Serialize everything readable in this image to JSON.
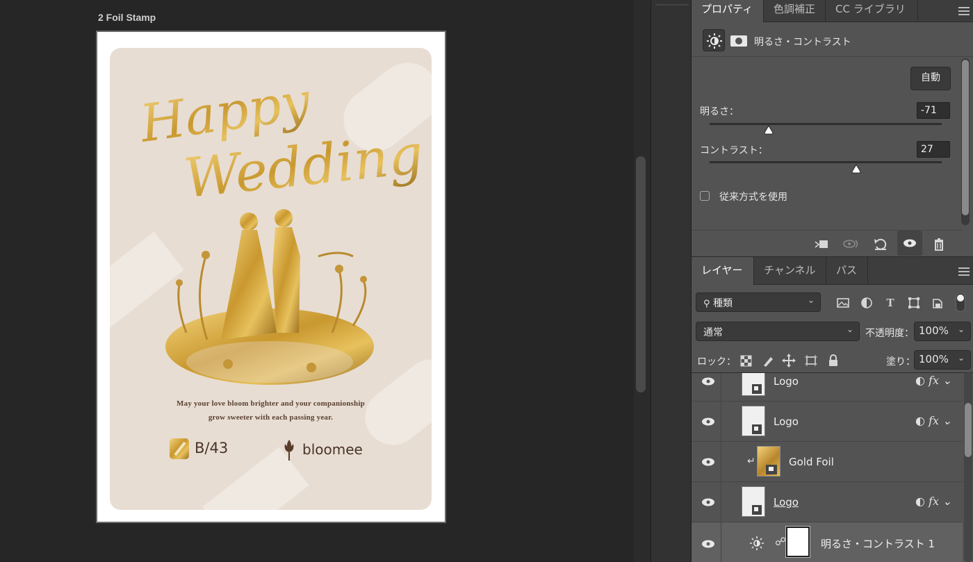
{
  "document": {
    "title": "2 Foil Stamp",
    "card": {
      "headline_1": "Happy",
      "headline_2": "Wedding",
      "tagline_1": "May your love bloom brighter and your companionship",
      "tagline_2": "grow sweeter with each passing year.",
      "logo_left": "B/43",
      "logo_right": "bloomee"
    }
  },
  "properties_panel": {
    "tabs": [
      {
        "label": "プロパティ",
        "active": true
      },
      {
        "label": "色調補正",
        "active": false
      },
      {
        "label": "CC ライブラリ",
        "active": false
      }
    ],
    "adjustment_title": "明るさ・コントラスト",
    "auto_button": "自動",
    "brightness": {
      "label": "明るさ：",
      "value": "-71",
      "level": -71,
      "range": [
        -150,
        150
      ]
    },
    "contrast": {
      "label": "コントラスト：",
      "value": "27",
      "level": 27,
      "range": [
        -50,
        100
      ]
    },
    "legacy_checkbox": {
      "label": "従来方式を使用",
      "checked": false
    },
    "footer_icons": [
      "clip-to-layer-icon",
      "view-previous-state-icon",
      "reset-icon",
      "visibility-icon",
      "trash-icon"
    ]
  },
  "layers_panel": {
    "tabs": [
      {
        "label": "レイヤー",
        "active": true
      },
      {
        "label": "チャンネル",
        "active": false
      },
      {
        "label": "パス",
        "active": false
      }
    ],
    "filter_kind": "種類",
    "blend_mode": "通常",
    "opacity_label": "不透明度：",
    "opacity_value": "100%",
    "lock_label": "ロック：",
    "fill_label": "塗り：",
    "fill_value": "100%",
    "layers": [
      {
        "name": "Logo",
        "type": "smart",
        "fx": "fx",
        "visible": true
      },
      {
        "name": "Logo",
        "type": "smart",
        "fx": "fx",
        "visible": true
      },
      {
        "name": "Gold Foil",
        "type": "smart-clipped",
        "fx": "",
        "visible": true
      },
      {
        "name": "Logo",
        "type": "smart",
        "fx": "fx",
        "visible": true
      },
      {
        "name": "明るさ・コントラスト 1",
        "type": "adjustment",
        "fx": "",
        "visible": true
      }
    ]
  },
  "colors": {
    "app_bg": "#262626",
    "panel_bg": "#535353",
    "card_bg": "#e7ddd3",
    "gold": "#c9a04a"
  }
}
